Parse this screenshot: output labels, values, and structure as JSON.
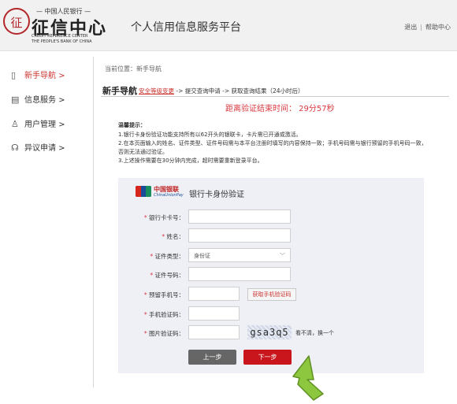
{
  "header": {
    "logo_char": "征",
    "logo_top": "— 中国人民银行 —",
    "logo_main": "征信中心",
    "logo_en1": "CREDIT REFERENCE CENTER",
    "logo_en2": "THE PEOPLE'S BANK OF CHINA",
    "platform_title": "个人信用信息服务平台",
    "links": {
      "logout": "退出",
      "separator": "|",
      "help": "帮助中心"
    }
  },
  "sidebar": {
    "items": [
      {
        "label": "新手导航 >",
        "icon": "book-icon",
        "glyph": "📖",
        "active": true
      },
      {
        "label": "信息服务 >",
        "icon": "document-icon",
        "glyph": "▤",
        "active": false
      },
      {
        "label": "用户管理 >",
        "icon": "user-icon",
        "glyph": "♙",
        "active": false
      },
      {
        "label": "异议申请 >",
        "icon": "headset-icon",
        "glyph": "☊",
        "active": false
      }
    ]
  },
  "main": {
    "breadcrumb": "当前位置：新手导航",
    "section_title": "新手导航",
    "steps": {
      "current": "安全等级变更",
      "rest": " -> 提交查询申请 -> 获取查询结果（24小时后）"
    },
    "countdown": "距离验证结束时间：  29分57秒",
    "tips": {
      "heading": "温馨提示：",
      "lines": [
        "1.银行卡身份验证功能支持所有以62开头的银联卡，卡片需已开通或激活。",
        "2.在本页面输入的姓名、证件类型、证件号码需与本平台注册时填写的内容保持一致；手机号码需与银行预留的手机号码一致，",
        "否则无法通过验证。",
        "3.上述操作需要在30分钟内完成，超时需要重新登录平台。"
      ]
    }
  },
  "form": {
    "unionpay_cn": "中国银联",
    "unionpay_en": "ChinaUnionPay",
    "title": "银行卡身份验证",
    "required_mark": "*",
    "fields": {
      "card_number": {
        "label": " 银行卡卡号：",
        "value": ""
      },
      "name": {
        "label": " 姓名：",
        "value": ""
      },
      "id_type": {
        "label": " 证件类型：",
        "value": "身份证"
      },
      "id_number": {
        "label": " 证件号码：",
        "value": ""
      },
      "phone": {
        "label": " 预留手机号：",
        "value": ""
      },
      "sms_code": {
        "label": " 手机验证码：",
        "value": ""
      },
      "captcha": {
        "label": " 图片验证码：",
        "value": ""
      }
    },
    "get_sms_button": "获取手机验证码",
    "captcha_text": "gsa3q5",
    "captcha_refresh": "看不清，换一个",
    "prev_button": "上一步",
    "next_button": "下一步"
  },
  "colors": {
    "accent": "#c9161d",
    "panel": "#eef0f6",
    "arrow": "#8dc63f"
  }
}
